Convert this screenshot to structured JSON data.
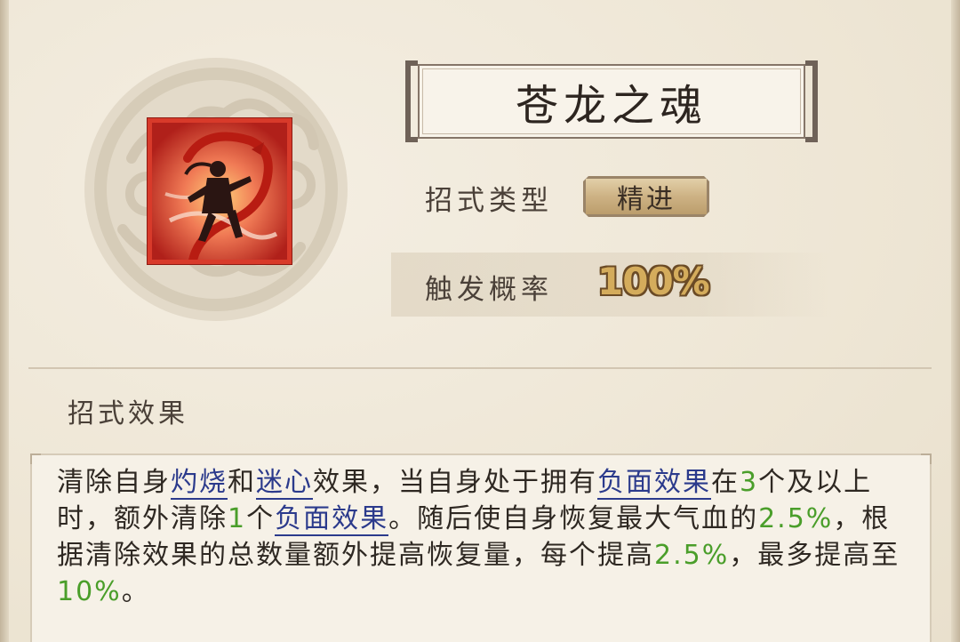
{
  "skill": {
    "name": "苍龙之魂",
    "type_label": "招式类型",
    "type_value": "精进",
    "rate_label": "触发概率",
    "rate_value": "100%",
    "icon": "dragon-warrior-skill-icon"
  },
  "effect": {
    "heading": "招式效果",
    "t1": "清除自身",
    "k1": "灼烧",
    "t2": "和",
    "k2": "迷心",
    "t3": "效果，当自身处于拥有",
    "k3": "负面效果",
    "t4": "在",
    "n1": "3",
    "t5": "个及以上时，额外清除",
    "n2": "1",
    "t6": "个",
    "k4": "负面效果",
    "t7": "。随后使自身恢复最大气血的",
    "n3": "2.5%",
    "t8": "，根据清除效果的总数量额外提高恢复量，每个提高",
    "n4": "2.5%",
    "t9": "，最多提高至",
    "n5": "10%",
    "t10": "。"
  },
  "colors": {
    "keyword": "#2b3a8c",
    "number": "#4a9e2a",
    "rate_gold": "#d4ac5c",
    "icon_red": "#d83a2a"
  }
}
